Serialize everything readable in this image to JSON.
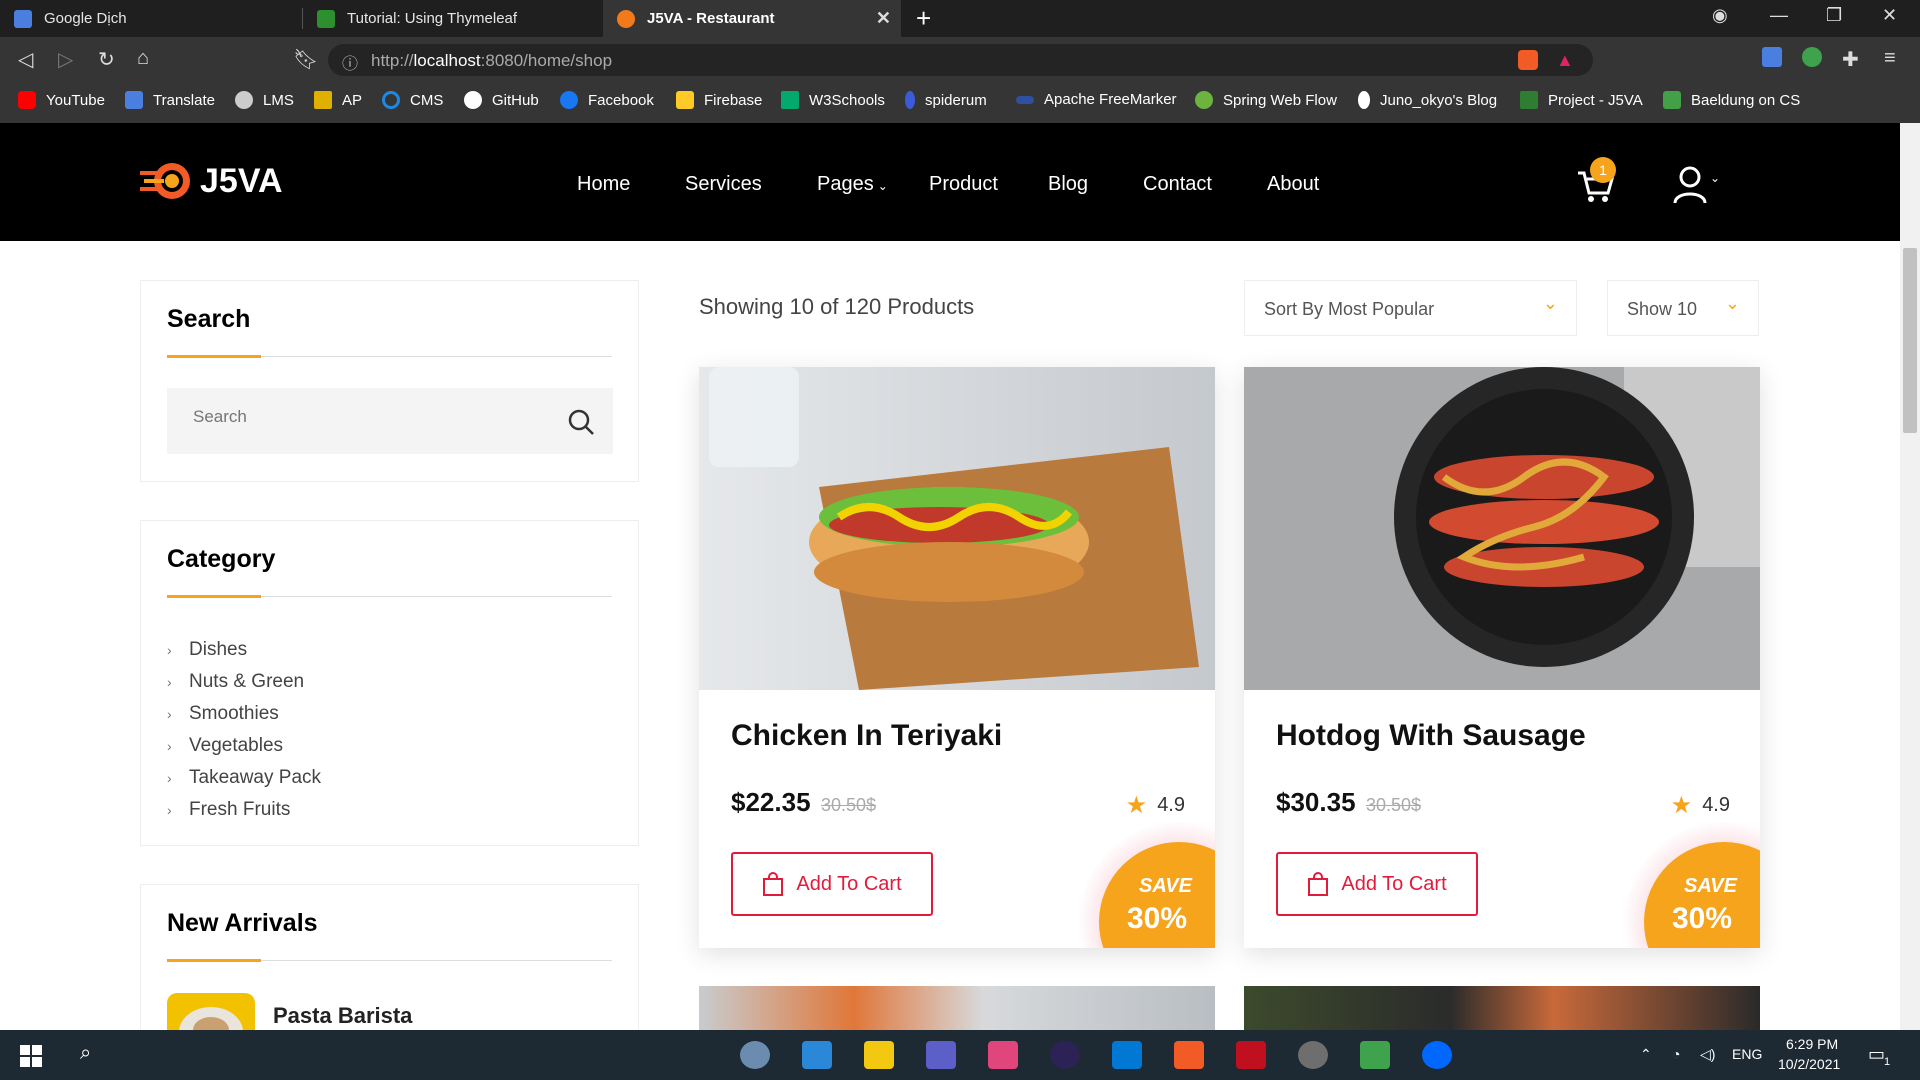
{
  "browser": {
    "tabs": [
      {
        "title": "Google Dịch",
        "color": "#4a7fe0"
      },
      {
        "title": "Tutorial: Using Thymeleaf",
        "color": "#2d8f2d"
      },
      {
        "title": "J5VA - Restaurant",
        "color": "#f27a1a",
        "active": true
      }
    ],
    "url_host": "localhost",
    "url_prefix": "http://",
    "url_suffix": ":8080/home/shop",
    "bookmarks": [
      {
        "label": "YouTube",
        "color": "#ff0000"
      },
      {
        "label": "Translate",
        "color": "#4a7fe0"
      },
      {
        "label": "LMS",
        "color": "#cccccc"
      },
      {
        "label": "AP",
        "color": "#e0b000"
      },
      {
        "label": "CMS",
        "color": "#1e88e5"
      },
      {
        "label": "GitHub",
        "color": "#ffffff"
      },
      {
        "label": "Facebook",
        "color": "#1877f2"
      },
      {
        "label": "Firebase",
        "color": "#ffca28"
      },
      {
        "label": "W3Schools",
        "color": "#04aa6d"
      },
      {
        "label": "spiderum",
        "color": "#3b5bdb"
      },
      {
        "label": "Apache FreeMarker",
        "color": "#2f4f9f"
      },
      {
        "label": "Spring Web Flow",
        "color": "#6db33f"
      },
      {
        "label": "Juno_okyo's Blog",
        "color": "#ffffff"
      },
      {
        "label": "Project - J5VA",
        "color": "#2e7d32"
      },
      {
        "label": "Baeldung on CS",
        "color": "#43a047"
      }
    ]
  },
  "site": {
    "logo_text": "J5VA",
    "nav": [
      "Home",
      "Services",
      "Pages",
      "Product",
      "Blog",
      "Contact",
      "About"
    ],
    "cart_count": "1"
  },
  "sidebar": {
    "search_title": "Search",
    "search_placeholder": "Search",
    "category_title": "Category",
    "categories": [
      "Dishes",
      "Nuts & Green",
      "Smoothies",
      "Vegetables",
      "Takeaway Pack",
      "Fresh Fruits"
    ],
    "arrivals_title": "New Arrivals",
    "arrival_item": "Pasta Barista"
  },
  "shop": {
    "showing": "Showing 10 of 120 Products",
    "sort_label": "Sort By Most Popular",
    "show_label": "Show 10",
    "products": [
      {
        "name": "Chicken In Teriyaki",
        "price": "$22.35",
        "old_price": "30.50$",
        "rating": "4.9",
        "button": "Add To Cart",
        "save_word": "SAVE",
        "save_pct": "30%"
      },
      {
        "name": "Hotdog With Sausage",
        "price": "$30.35",
        "old_price": "30.50$",
        "rating": "4.9",
        "button": "Add To Cart",
        "save_word": "SAVE",
        "save_pct": "30%"
      }
    ]
  },
  "taskbar": {
    "language": "ENG",
    "time": "6:29 PM",
    "date": "10/2/2021",
    "notifications": "1"
  },
  "colors": {
    "accent": "#f7a41d",
    "cta": "#e21b3c"
  }
}
